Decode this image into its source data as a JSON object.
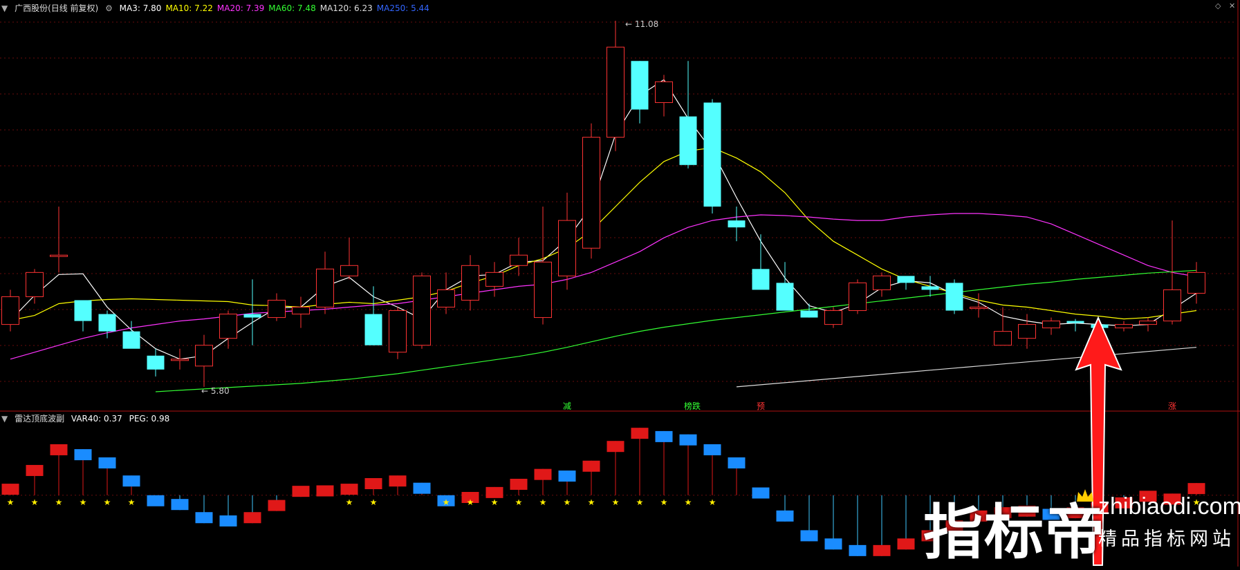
{
  "header": {
    "stock": "广西股份(日线 前复权)",
    "ma": [
      {
        "label": "MA3: 7.80",
        "color": "#ffffff"
      },
      {
        "label": "MA10: 7.22",
        "color": "#ffff00"
      },
      {
        "label": "MA20: 7.39",
        "color": "#ff33ff"
      },
      {
        "label": "MA60: 7.48",
        "color": "#33ff33"
      },
      {
        "label": "MA120: 6.23",
        "color": "#dddddd"
      },
      {
        "label": "MA250: 5.44",
        "color": "#3366ff"
      }
    ]
  },
  "sub_header": {
    "name": "雷达顶底波副",
    "var40": "VAR40: 0.37",
    "peg": "PEG: 0.98"
  },
  "watermark": {
    "cn": "指标帝",
    "url": "zhibiaodi.com",
    "sub": "精品指标网站"
  },
  "chart_data": [
    {
      "type": "candlestick",
      "high_label": "11.08",
      "low_label": "5.80",
      "open": [
        6.7,
        7.1,
        7.7,
        7.05,
        6.85,
        6.6,
        6.25,
        6.2,
        6.1,
        6.5,
        6.85,
        6.8,
        6.85,
        6.95,
        7.4,
        6.85,
        6.3,
        6.4,
        6.95,
        7.05,
        7.25,
        7.55,
        6.8,
        7.4,
        7.8,
        9.4,
        10.5,
        9.9,
        9.7,
        9.9,
        8.2,
        7.5,
        7.3,
        6.9,
        6.7,
        6.9,
        7.2,
        7.4,
        7.25,
        7.3,
        6.95,
        6.4,
        6.5,
        6.65,
        6.75,
        6.7,
        6.65,
        6.7,
        6.75,
        7.15
      ],
      "close": [
        7.1,
        7.45,
        7.7,
        6.75,
        6.6,
        6.35,
        6.05,
        6.2,
        6.4,
        6.85,
        6.8,
        7.05,
        6.95,
        7.5,
        7.55,
        6.4,
        6.9,
        7.4,
        7.2,
        7.55,
        7.45,
        7.7,
        7.6,
        8.2,
        9.4,
        10.7,
        9.8,
        10.2,
        9.0,
        8.4,
        8.1,
        7.2,
        6.9,
        6.8,
        6.9,
        7.3,
        7.4,
        7.3,
        7.2,
        6.9,
        6.95,
        6.6,
        6.7,
        6.75,
        6.72,
        6.65,
        6.7,
        6.75,
        7.2,
        7.45
      ],
      "high": [
        7.2,
        7.5,
        8.4,
        6.9,
        6.9,
        6.75,
        6.35,
        6.35,
        6.55,
        6.9,
        7.35,
        7.15,
        7.1,
        7.75,
        7.95,
        7.25,
        6.95,
        7.45,
        7.45,
        7.7,
        7.6,
        7.95,
        8.4,
        8.6,
        9.6,
        11.08,
        10.5,
        10.3,
        10.5,
        9.95,
        8.4,
        8.0,
        7.6,
        7.0,
        6.95,
        7.35,
        7.45,
        7.35,
        7.4,
        7.35,
        7.15,
        6.95,
        6.85,
        6.8,
        6.78,
        6.75,
        6.75,
        6.8,
        8.2,
        7.6
      ],
      "low": [
        6.6,
        7.0,
        7.45,
        6.6,
        6.5,
        6.4,
        5.95,
        6.05,
        5.8,
        6.35,
        6.4,
        6.75,
        6.65,
        6.85,
        7.35,
        6.4,
        6.2,
        6.35,
        6.85,
        6.9,
        7.1,
        7.4,
        6.7,
        7.2,
        7.65,
        9.2,
        9.6,
        9.7,
        8.95,
        8.3,
        7.9,
        7.4,
        7.15,
        6.8,
        6.65,
        6.85,
        7.1,
        7.2,
        7.1,
        6.85,
        6.8,
        6.45,
        6.35,
        6.55,
        6.6,
        6.55,
        6.6,
        6.6,
        6.7,
        7.0
      ],
      "series": [
        {
          "name": "MA3",
          "color": "#ffffff",
          "values": [
            6.76,
            7.12,
            7.42,
            7.43,
            6.95,
            6.62,
            6.35,
            6.2,
            6.25,
            6.5,
            6.73,
            6.94,
            6.95,
            7.25,
            7.38,
            7.1,
            6.95,
            6.78,
            7.2,
            7.4,
            7.42,
            7.6,
            7.62,
            7.93,
            8.4,
            9.44,
            10.0,
            10.23,
            9.67,
            9.2,
            8.53,
            7.9,
            7.37,
            6.97,
            6.87,
            7.0,
            7.23,
            7.33,
            7.3,
            7.13,
            7.02,
            6.82,
            6.75,
            6.7,
            6.72,
            6.7,
            6.68,
            6.7,
            6.92,
            7.15
          ]
        },
        {
          "name": "MA10",
          "color": "#ffff00",
          "values": [
            6.76,
            6.83,
            7.0,
            7.04,
            7.06,
            7.07,
            7.06,
            7.05,
            7.04,
            7.03,
            6.98,
            6.97,
            6.95,
            6.99,
            7.02,
            7.0,
            7.05,
            7.1,
            7.18,
            7.3,
            7.4,
            7.55,
            7.65,
            7.8,
            8.05,
            8.4,
            8.75,
            9.05,
            9.2,
            9.25,
            9.1,
            8.9,
            8.6,
            8.2,
            7.9,
            7.7,
            7.5,
            7.35,
            7.25,
            7.15,
            7.05,
            6.98,
            6.95,
            6.9,
            6.85,
            6.82,
            6.78,
            6.8,
            6.85,
            6.9
          ]
        },
        {
          "name": "MA20",
          "color": "#ff33ff",
          "values": [
            6.2,
            6.3,
            6.4,
            6.5,
            6.58,
            6.65,
            6.7,
            6.75,
            6.78,
            6.82,
            6.86,
            6.88,
            6.9,
            6.92,
            6.95,
            6.98,
            7.0,
            7.05,
            7.1,
            7.15,
            7.2,
            7.25,
            7.28,
            7.35,
            7.45,
            7.6,
            7.75,
            7.95,
            8.1,
            8.2,
            8.25,
            8.28,
            8.27,
            8.25,
            8.22,
            8.2,
            8.2,
            8.25,
            8.28,
            8.3,
            8.3,
            8.28,
            8.25,
            8.15,
            8.0,
            7.85,
            7.7,
            7.55,
            7.45,
            7.39
          ]
        },
        {
          "name": "MA60",
          "color": "#33ff33",
          "values": [
            null,
            null,
            null,
            null,
            null,
            null,
            5.73,
            5.75,
            5.77,
            5.79,
            5.81,
            5.83,
            5.85,
            5.88,
            5.91,
            5.95,
            5.99,
            6.04,
            6.09,
            6.14,
            6.19,
            6.24,
            6.3,
            6.37,
            6.45,
            6.53,
            6.6,
            6.66,
            6.71,
            6.76,
            6.8,
            6.84,
            6.88,
            6.92,
            6.96,
            7.0,
            7.04,
            7.08,
            7.12,
            7.16,
            7.2,
            7.24,
            7.28,
            7.31,
            7.35,
            7.38,
            7.41,
            7.44,
            7.46,
            7.48
          ]
        },
        {
          "name": "MA120",
          "color": "#dddddd",
          "values": [
            null,
            null,
            null,
            null,
            null,
            null,
            null,
            null,
            null,
            null,
            null,
            null,
            null,
            null,
            null,
            null,
            null,
            null,
            null,
            null,
            null,
            null,
            null,
            null,
            null,
            null,
            null,
            null,
            null,
            null,
            5.8,
            5.83,
            5.86,
            5.89,
            5.92,
            5.95,
            5.98,
            6.01,
            6.04,
            6.07,
            6.1,
            6.13,
            6.16,
            6.19,
            6.22,
            6.25,
            6.28,
            6.31,
            6.34,
            6.37
          ]
        }
      ],
      "markers": [
        {
          "index": 23,
          "text": "减",
          "color": "#33ff33"
        },
        {
          "index": 28,
          "text": "榜跌",
          "color": "#33ff33"
        },
        {
          "index": 31,
          "text": "预",
          "color": "#ff3333"
        },
        {
          "index": 48,
          "text": "涨",
          "color": "#ff3333"
        }
      ],
      "ylim": [
        5.6,
        11.2
      ]
    },
    {
      "type": "bar",
      "values": [
        0.35,
        0.92,
        1.55,
        1.4,
        1.15,
        0.6,
        0.0,
        -0.45,
        -0.85,
        -0.95,
        -0.85,
        -0.48,
        -0.05,
        0.3,
        0.35,
        0.52,
        0.6,
        0.38,
        0.0,
        0.1,
        0.25,
        0.5,
        0.8,
        0.75,
        1.05,
        1.65,
        2.05,
        1.95,
        1.85,
        1.55,
        1.15,
        -0.1,
        -0.8,
        -1.4,
        -1.65,
        -1.85,
        -1.85,
        -1.65,
        -1.4,
        -1.1,
        -0.8,
        -0.7,
        -0.65,
        -0.75,
        -0.7,
        -0.55,
        -0.4,
        -0.2,
        0.05,
        0.37
      ],
      "stars": [
        0,
        1,
        2,
        3,
        4,
        5,
        14,
        15,
        18,
        19,
        20,
        21,
        22,
        23,
        24,
        25,
        26,
        27,
        28,
        29,
        49
      ],
      "ylim": [
        -2.0,
        2.2
      ]
    }
  ]
}
